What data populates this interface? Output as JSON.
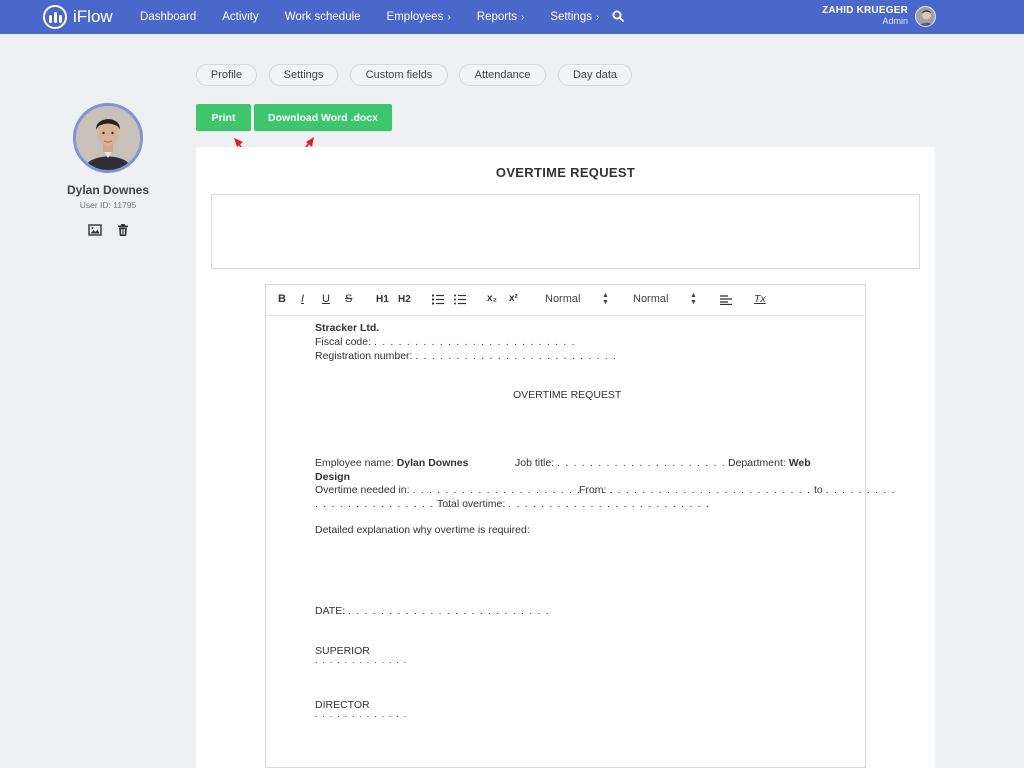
{
  "app": {
    "name": "iFlow"
  },
  "nav": {
    "items": [
      {
        "label": "Dashboard",
        "chevron": false
      },
      {
        "label": "Activity",
        "chevron": false
      },
      {
        "label": "Work schedule",
        "chevron": false
      },
      {
        "label": "Employees",
        "chevron": true
      },
      {
        "label": "Reports",
        "chevron": true
      },
      {
        "label": "Settings",
        "chevron": true
      }
    ],
    "chevron_glyph": "›"
  },
  "user": {
    "name": "ZAHID KRUEGER",
    "role": "Admin"
  },
  "tabs": [
    "Profile",
    "Settings",
    "Custom fields",
    "Attendance",
    "Day data"
  ],
  "buttons": {
    "print": "Print",
    "download": "Download Word .docx"
  },
  "profile": {
    "name": "Dylan Downes",
    "user_id": "User ID: 11795"
  },
  "card": {
    "title": "OVERTIME REQUEST"
  },
  "editor": {
    "toolbar": {
      "bold": "B",
      "italic": "I",
      "underline": "U",
      "strike": "S",
      "h1": "H1",
      "h2": "H2",
      "sub": "x₂",
      "sup": "x²",
      "select1": "Normal",
      "select2": "Normal",
      "clear": "Tx"
    },
    "document": {
      "company": "Stracker Ltd.",
      "fiscal_label": "Fiscal code:",
      "registration_label": "Registration number:",
      "title": "OVERTIME REQUEST",
      "employee_label": "Employee name:",
      "employee_name": "Dylan Downes",
      "job_label": "Job title:",
      "department_label": "Department:",
      "department_value_1": "Web",
      "department_value_2": "Design",
      "overtime_label": "Overtime needed in:",
      "from_label": "From:",
      "to_label": "to",
      "total_label": "Total overtime:",
      "explanation_label": "Detailed explanation why overtime is required:",
      "date_label": "DATE:",
      "superior_label": "SUPERIOR",
      "director_label": "DIRECTOR",
      "dots": ". . . . . . . . . . . . . . . . . . . . . . . . .",
      "dots_short": ". . . . . . . . .",
      "dots_mid": ". . . . . . . . . . . . . . . . .",
      "dots_sig": ". . . . . . . . . . . . ."
    }
  },
  "colors": {
    "topbar": "#4a68c9",
    "button": "#3fc56d",
    "arrow": "#e02020"
  }
}
